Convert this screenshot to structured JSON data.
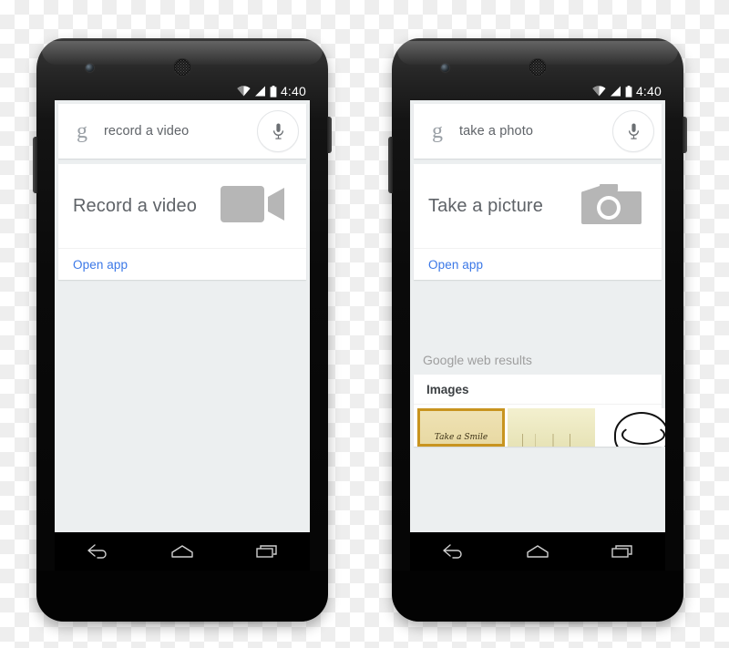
{
  "scene": {
    "description": "Two Android phone mockups showing Google Now voice search results"
  },
  "phones": [
    {
      "id": "left",
      "status_bar": {
        "time": "4:40",
        "icons": [
          "wifi-icon",
          "signal-icon",
          "battery-icon"
        ]
      },
      "search": {
        "logo": "g",
        "query": "record a video",
        "mic_label": "mic-icon"
      },
      "app_card": {
        "title": "Record a video",
        "icon": "video-camera-icon",
        "open_app_label": "Open app"
      },
      "web_results": null,
      "nav": {
        "back": "back-icon",
        "home": "home-icon",
        "recents": "recents-icon"
      }
    },
    {
      "id": "right",
      "status_bar": {
        "time": "4:40",
        "icons": [
          "wifi-icon",
          "signal-icon",
          "battery-icon"
        ]
      },
      "search": {
        "logo": "g",
        "query": "take a photo",
        "mic_label": "mic-icon"
      },
      "app_card": {
        "title": "Take a picture",
        "icon": "camera-icon",
        "open_app_label": "Open app"
      },
      "web_results": {
        "section_label": "Google web results",
        "images_header": "Images",
        "thumbnails": [
          {
            "caption": "Take a Smile"
          },
          {
            "caption": ""
          },
          {
            "caption": ""
          }
        ]
      },
      "nav": {
        "back": "back-icon",
        "home": "home-icon",
        "recents": "recents-icon"
      }
    }
  ],
  "colors": {
    "link": "#3b78e7",
    "screen_bg": "#eceff0",
    "card_bg": "#ffffff",
    "text_secondary": "#5f6368",
    "icon_gray": "#bdbdbd"
  }
}
